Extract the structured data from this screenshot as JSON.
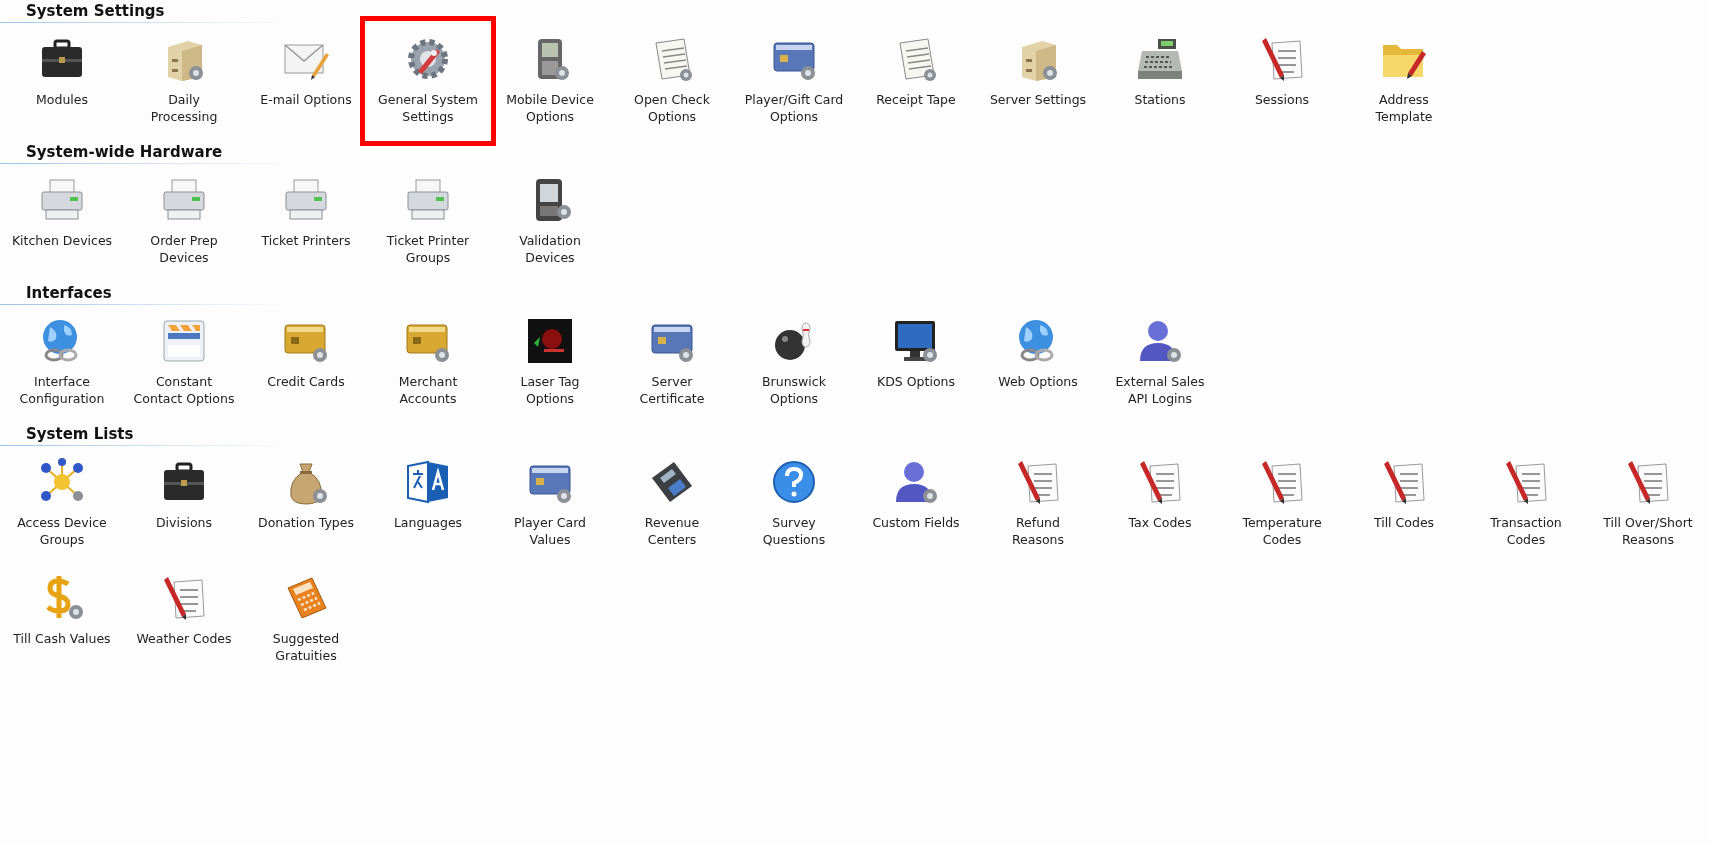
{
  "sections": [
    {
      "title": "System Settings",
      "items": [
        {
          "lines": [
            "Modules"
          ],
          "kind": "briefcase",
          "highlighted": false
        },
        {
          "lines": [
            "Daily",
            "Processing"
          ],
          "kind": "box",
          "highlighted": false
        },
        {
          "lines": [
            "E-mail Options"
          ],
          "kind": "envelope",
          "highlighted": false
        },
        {
          "lines": [
            "General System",
            "Settings"
          ],
          "kind": "gear",
          "highlighted": true
        },
        {
          "lines": [
            "Mobile Device",
            "Options"
          ],
          "kind": "phone",
          "highlighted": false
        },
        {
          "lines": [
            "Open Check",
            "Options"
          ],
          "kind": "receipt",
          "highlighted": false
        },
        {
          "lines": [
            "Player/Gift Card",
            "Options"
          ],
          "kind": "card",
          "highlighted": false
        },
        {
          "lines": [
            "Receipt Tape"
          ],
          "kind": "receipt",
          "highlighted": false
        },
        {
          "lines": [
            "Server Settings"
          ],
          "kind": "box",
          "highlighted": false
        },
        {
          "lines": [
            "Stations"
          ],
          "kind": "register",
          "highlighted": false
        },
        {
          "lines": [
            "Sessions"
          ],
          "kind": "checklist",
          "highlighted": false
        },
        {
          "lines": [
            "Address",
            "Template"
          ],
          "kind": "folder",
          "highlighted": false
        }
      ]
    },
    {
      "title": "System-wide Hardware",
      "items": [
        {
          "lines": [
            "Kitchen Devices"
          ],
          "kind": "printer",
          "highlighted": false
        },
        {
          "lines": [
            "Order Prep",
            "Devices"
          ],
          "kind": "printer",
          "highlighted": false
        },
        {
          "lines": [
            "Ticket Printers"
          ],
          "kind": "printer",
          "highlighted": false
        },
        {
          "lines": [
            "Ticket Printer",
            "Groups"
          ],
          "kind": "printer",
          "highlighted": false
        },
        {
          "lines": [
            "Validation",
            "Devices"
          ],
          "kind": "handheld",
          "highlighted": false
        }
      ]
    },
    {
      "title": "Interfaces",
      "items": [
        {
          "lines": [
            "Interface",
            "Configuration"
          ],
          "kind": "globe",
          "highlighted": false
        },
        {
          "lines": [
            "Constant",
            "Contact Options"
          ],
          "kind": "contact",
          "highlighted": false
        },
        {
          "lines": [
            "Credit Cards"
          ],
          "kind": "goldcard",
          "highlighted": false
        },
        {
          "lines": [
            "Merchant",
            "Accounts"
          ],
          "kind": "goldcard",
          "highlighted": false
        },
        {
          "lines": [
            "Laser Tag",
            "Options"
          ],
          "kind": "laser",
          "highlighted": false
        },
        {
          "lines": [
            "Server",
            "Certificate"
          ],
          "kind": "card",
          "highlighted": false
        },
        {
          "lines": [
            "Brunswick",
            "Options"
          ],
          "kind": "bowling",
          "highlighted": false
        },
        {
          "lines": [
            "KDS Options"
          ],
          "kind": "monitor",
          "highlighted": false
        },
        {
          "lines": [
            "Web Options"
          ],
          "kind": "globe",
          "highlighted": false
        },
        {
          "lines": [
            "External Sales",
            "API Logins"
          ],
          "kind": "person",
          "highlighted": false
        }
      ]
    },
    {
      "title": "System Lists",
      "items": [
        {
          "lines": [
            "Access Device",
            "Groups"
          ],
          "kind": "network",
          "highlighted": false
        },
        {
          "lines": [
            "Divisions"
          ],
          "kind": "briefcase",
          "highlighted": false
        },
        {
          "lines": [
            "Donation Types"
          ],
          "kind": "moneybag",
          "highlighted": false
        },
        {
          "lines": [
            "Languages"
          ],
          "kind": "languages",
          "highlighted": false
        },
        {
          "lines": [
            "Player Card",
            "Values"
          ],
          "kind": "card",
          "highlighted": false
        },
        {
          "lines": [
            "Revenue",
            "Centers"
          ],
          "kind": "calculator",
          "highlighted": false
        },
        {
          "lines": [
            "Survey",
            "Questions"
          ],
          "kind": "question",
          "highlighted": false
        },
        {
          "lines": [
            "Custom Fields"
          ],
          "kind": "person",
          "highlighted": false
        },
        {
          "lines": [
            "Refund",
            "Reasons"
          ],
          "kind": "checklist",
          "highlighted": false
        },
        {
          "lines": [
            "Tax Codes"
          ],
          "kind": "checklist",
          "highlighted": false
        },
        {
          "lines": [
            "Temperature",
            "Codes"
          ],
          "kind": "checklist",
          "highlighted": false
        },
        {
          "lines": [
            "Till Codes"
          ],
          "kind": "checklist",
          "highlighted": false
        },
        {
          "lines": [
            "Transaction",
            "Codes"
          ],
          "kind": "checklist",
          "highlighted": false
        },
        {
          "lines": [
            "Till Over/Short",
            "Reasons"
          ],
          "kind": "checklist",
          "highlighted": false
        },
        {
          "lines": [
            "Till Cash Values"
          ],
          "kind": "dollar",
          "highlighted": false
        },
        {
          "lines": [
            "Weather Codes"
          ],
          "kind": "checklist",
          "highlighted": false
        },
        {
          "lines": [
            "Suggested",
            "Gratuities"
          ],
          "kind": "calculator-orange",
          "highlighted": false
        }
      ]
    }
  ]
}
